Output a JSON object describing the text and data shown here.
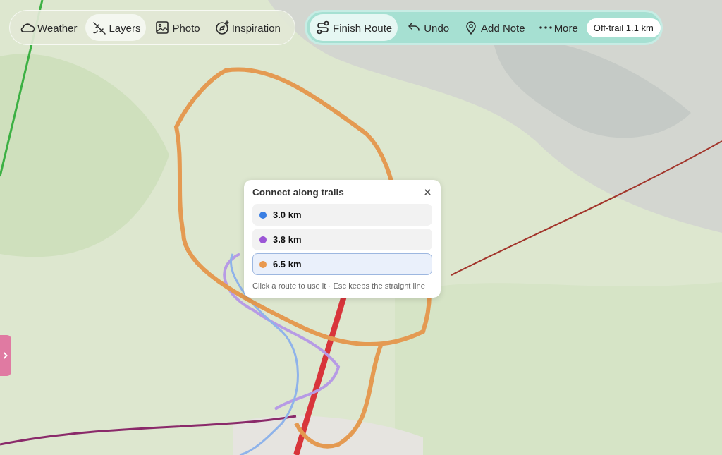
{
  "map_toolbar": {
    "buttons": [
      {
        "label": "Weather",
        "selected": false
      },
      {
        "label": "Layers",
        "selected": true
      },
      {
        "label": "Photo",
        "selected": false
      },
      {
        "label": "Inspiration",
        "selected": false
      }
    ]
  },
  "route_toolbar": {
    "buttons": [
      {
        "label": "Finish Route",
        "kind": "primary"
      },
      {
        "label": "Undo",
        "kind": "plain"
      },
      {
        "label": "Add Note",
        "kind": "plain"
      },
      {
        "label": "More",
        "kind": "plain"
      }
    ],
    "off_trail_badge": "Off-trail 1.1 km"
  },
  "route_options_popup": {
    "title": "Connect along trails",
    "options": [
      {
        "label": "3.0 km",
        "color": "#3b7fe3",
        "selected": false
      },
      {
        "label": "3.8 km",
        "color": "#9b55d6",
        "selected": false
      },
      {
        "label": "6.5 km",
        "color": "#e9994f",
        "selected": true
      }
    ],
    "hint": "Click a route to use it · Esc keeps the straight line"
  }
}
